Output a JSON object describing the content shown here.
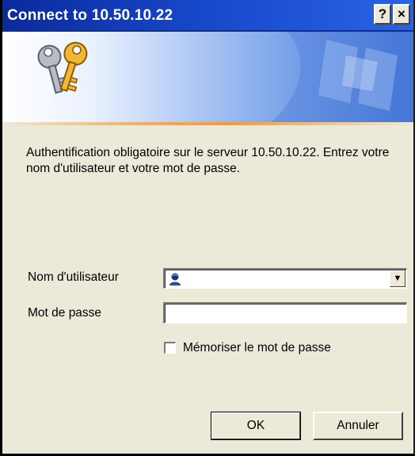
{
  "window": {
    "title": "Connect to 10.50.10.22",
    "help_label": "?",
    "close_label": "×"
  },
  "banner": {
    "icon": "keys-icon"
  },
  "message": "Authentification obligatoire sur le serveur 10.50.10.22.  Entrez votre nom d'utilisateur et votre mot de passe.",
  "form": {
    "username_label": "Nom d'utilisateur",
    "username_value": "",
    "username_icon": "user-icon",
    "password_label": "Mot de passe",
    "password_value": "",
    "remember_label": "Mémoriser le mot de passe",
    "remember_checked": false
  },
  "buttons": {
    "ok_label": "OK",
    "cancel_label": "Annuler"
  },
  "colors": {
    "titlebar": "#1646c8",
    "dialog_bg": "#ece9d8",
    "accent_line": "#f59a2f"
  }
}
